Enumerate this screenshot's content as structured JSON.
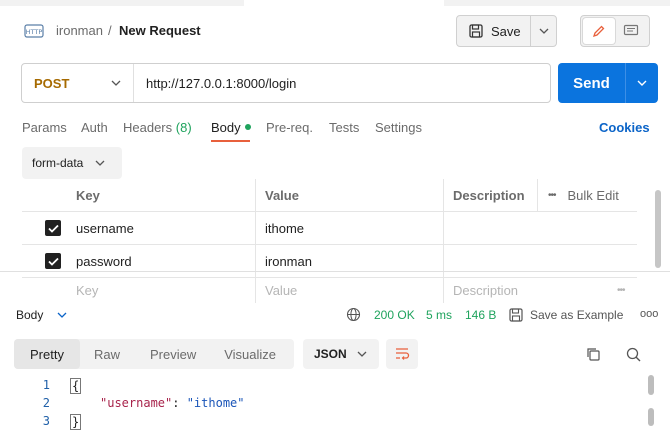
{
  "header": {
    "breadcrumb_parent": "ironman",
    "breadcrumb_separator": "/",
    "title": "New Request",
    "save_label": "Save"
  },
  "request": {
    "method": "POST",
    "url": "http://127.0.0.1:8000/login",
    "send_label": "Send"
  },
  "tabs": [
    {
      "label": "Params"
    },
    {
      "label": "Auth"
    },
    {
      "label": "Headers",
      "count": "(8)"
    },
    {
      "label": "Body"
    },
    {
      "label": "Pre-req."
    },
    {
      "label": "Tests"
    },
    {
      "label": "Settings"
    }
  ],
  "cookies_label": "Cookies",
  "body_type": "form-data",
  "table": {
    "headers": {
      "key": "Key",
      "value": "Value",
      "description": "Description",
      "bulk_edit": "Bulk Edit",
      "more": "•••"
    },
    "rows": [
      {
        "key": "username",
        "value": "ithome",
        "description": ""
      },
      {
        "key": "password",
        "value": "ironman",
        "description": ""
      }
    ],
    "placeholder": {
      "key": "Key",
      "value": "Value",
      "description": "Description",
      "more": "•••"
    }
  },
  "response": {
    "label": "Body",
    "status": "200 OK",
    "time": "5 ms",
    "size": "146 B",
    "save_example": "Save as Example",
    "more": "ooo",
    "tabs": [
      "Pretty",
      "Raw",
      "Preview",
      "Visualize"
    ],
    "format": "JSON",
    "code": {
      "line_numbers": [
        "1",
        "2",
        "3"
      ],
      "open": "{",
      "key": "\"username\"",
      "colon": ": ",
      "value": "\"ithome\"",
      "close": "}"
    }
  },
  "colors": {
    "accent": "#0b74de",
    "method": "#a66a00",
    "status_ok": "#1fa35d",
    "tab_indicator": "#e8603c"
  }
}
